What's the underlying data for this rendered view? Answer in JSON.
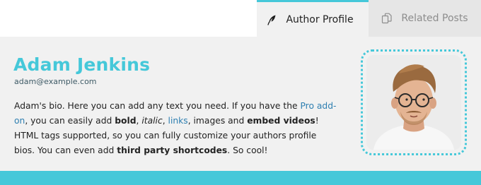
{
  "tabs": {
    "author_profile": {
      "label": "Author Profile",
      "icon": "quill-feather-icon"
    },
    "related_posts": {
      "label": "Related Posts",
      "icon": "documents-icon"
    }
  },
  "author": {
    "name": "Adam Jenkins",
    "email": "adam@example.com"
  },
  "bio": {
    "segments": [
      {
        "text": "Adam's bio. Here you can add any text you need. If you have the ",
        "style": "plain"
      },
      {
        "text": "Pro add-on",
        "style": "link"
      },
      {
        "text": ", you can easily add ",
        "style": "plain"
      },
      {
        "text": "bold",
        "style": "bold"
      },
      {
        "text": ", ",
        "style": "plain"
      },
      {
        "text": "italic",
        "style": "italic"
      },
      {
        "text": ", ",
        "style": "plain"
      },
      {
        "text": "links",
        "style": "link"
      },
      {
        "text": ", images and ",
        "style": "plain"
      },
      {
        "text": "embed videos",
        "style": "bold"
      },
      {
        "text": "! HTML tags supported, so you can fully customize your authors profile bios. You can even add ",
        "style": "plain"
      },
      {
        "text": "third party shortcodes",
        "style": "bold"
      },
      {
        "text": ". So cool!",
        "style": "plain"
      }
    ]
  },
  "colors": {
    "accent": "#45c8d9",
    "link": "#2e7fb1",
    "panel_bg": "#f1f1f1",
    "inactive_tab_bg": "#e6e6e6"
  }
}
